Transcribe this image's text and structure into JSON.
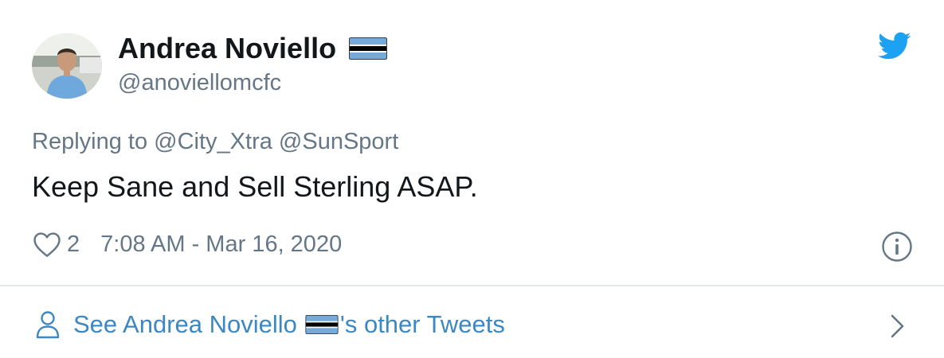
{
  "user": {
    "name": "Andrea Noviello",
    "flag_icon": "flag-botswana-icon",
    "handle": "@anoviellomcfc"
  },
  "brand_icon": "twitter-bird-icon",
  "reply": {
    "prefix": "Replying to",
    "mentions": [
      "@City_Xtra",
      "@SunSport"
    ]
  },
  "tweet_text": "Keep Sane and Sell Sterling ASAP.",
  "meta": {
    "like_icon": "heart-icon",
    "like_count": "2",
    "timestamp": "7:08 AM - Mar 16, 2020",
    "info_icon": "info-icon"
  },
  "more": {
    "icon": "person-icon",
    "prefix": "See Andrea Noviello",
    "suffix": "'s other Tweets",
    "chevron_icon": "chevron-right-icon"
  },
  "colors": {
    "text": "#14171a",
    "muted": "#657786",
    "link": "#3b88c3",
    "twitter_blue": "#1da1f2",
    "divider": "#e1e8ed",
    "flag_blue": "#75aadb"
  }
}
